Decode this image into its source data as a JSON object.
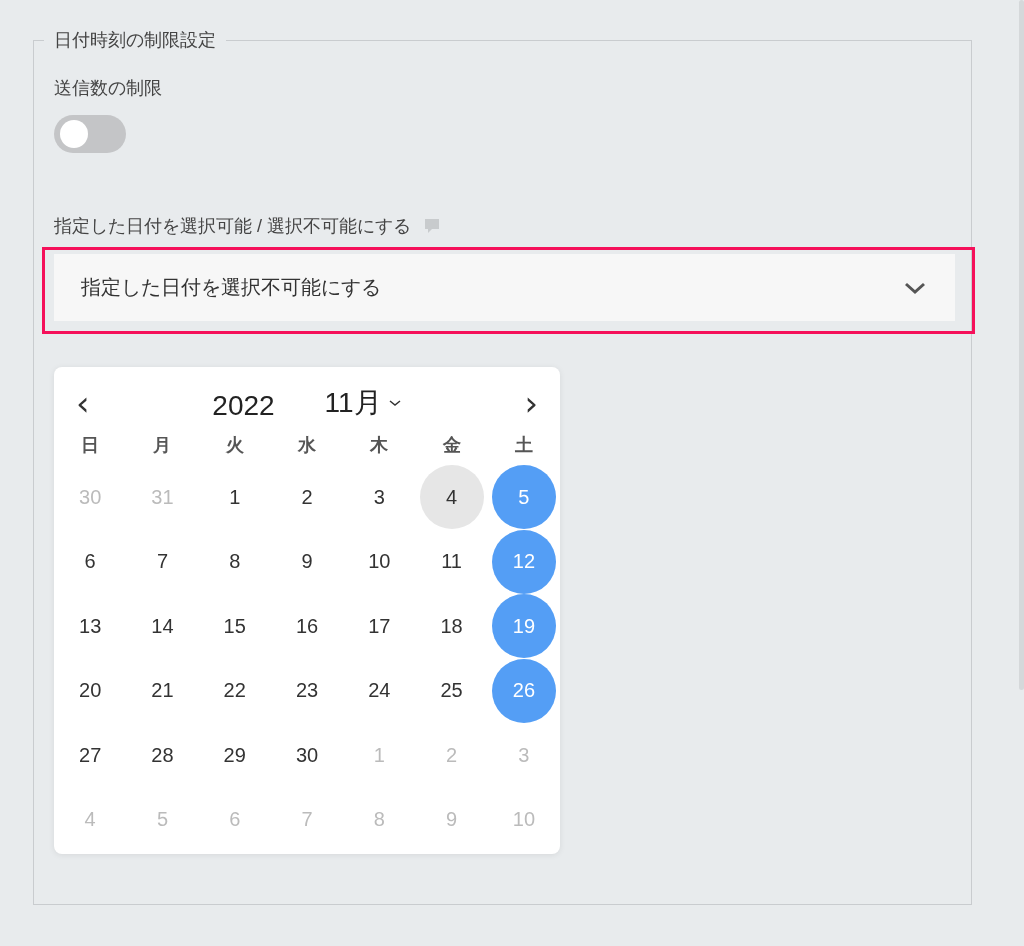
{
  "section": {
    "title": "日付時刻の制限設定"
  },
  "send_limit": {
    "label": "送信数の制限",
    "on": false
  },
  "date_mode": {
    "label": "指定した日付を選択可能 / 選択不可能にする",
    "value": "指定した日付を選択不可能にする",
    "focused": true
  },
  "calendar": {
    "prev": "‹",
    "next": "›",
    "year": "2022",
    "month": "11月",
    "weekdays": [
      "日",
      "月",
      "火",
      "水",
      "木",
      "金",
      "土"
    ],
    "days": [
      {
        "label": "30",
        "outside": true,
        "selected": false,
        "hovered": false
      },
      {
        "label": "31",
        "outside": true,
        "selected": false,
        "hovered": false
      },
      {
        "label": "1",
        "outside": false,
        "selected": false,
        "hovered": false
      },
      {
        "label": "2",
        "outside": false,
        "selected": false,
        "hovered": false
      },
      {
        "label": "3",
        "outside": false,
        "selected": false,
        "hovered": false
      },
      {
        "label": "4",
        "outside": false,
        "selected": false,
        "hovered": true
      },
      {
        "label": "5",
        "outside": false,
        "selected": true,
        "hovered": false
      },
      {
        "label": "6",
        "outside": false,
        "selected": false,
        "hovered": false
      },
      {
        "label": "7",
        "outside": false,
        "selected": false,
        "hovered": false
      },
      {
        "label": "8",
        "outside": false,
        "selected": false,
        "hovered": false
      },
      {
        "label": "9",
        "outside": false,
        "selected": false,
        "hovered": false
      },
      {
        "label": "10",
        "outside": false,
        "selected": false,
        "hovered": false
      },
      {
        "label": "11",
        "outside": false,
        "selected": false,
        "hovered": false
      },
      {
        "label": "12",
        "outside": false,
        "selected": true,
        "hovered": false
      },
      {
        "label": "13",
        "outside": false,
        "selected": false,
        "hovered": false
      },
      {
        "label": "14",
        "outside": false,
        "selected": false,
        "hovered": false
      },
      {
        "label": "15",
        "outside": false,
        "selected": false,
        "hovered": false
      },
      {
        "label": "16",
        "outside": false,
        "selected": false,
        "hovered": false
      },
      {
        "label": "17",
        "outside": false,
        "selected": false,
        "hovered": false
      },
      {
        "label": "18",
        "outside": false,
        "selected": false,
        "hovered": false
      },
      {
        "label": "19",
        "outside": false,
        "selected": true,
        "hovered": false
      },
      {
        "label": "20",
        "outside": false,
        "selected": false,
        "hovered": false
      },
      {
        "label": "21",
        "outside": false,
        "selected": false,
        "hovered": false
      },
      {
        "label": "22",
        "outside": false,
        "selected": false,
        "hovered": false
      },
      {
        "label": "23",
        "outside": false,
        "selected": false,
        "hovered": false
      },
      {
        "label": "24",
        "outside": false,
        "selected": false,
        "hovered": false
      },
      {
        "label": "25",
        "outside": false,
        "selected": false,
        "hovered": false
      },
      {
        "label": "26",
        "outside": false,
        "selected": true,
        "hovered": false
      },
      {
        "label": "27",
        "outside": false,
        "selected": false,
        "hovered": false
      },
      {
        "label": "28",
        "outside": false,
        "selected": false,
        "hovered": false
      },
      {
        "label": "29",
        "outside": false,
        "selected": false,
        "hovered": false
      },
      {
        "label": "30",
        "outside": false,
        "selected": false,
        "hovered": false
      },
      {
        "label": "1",
        "outside": true,
        "selected": false,
        "hovered": false
      },
      {
        "label": "2",
        "outside": true,
        "selected": false,
        "hovered": false
      },
      {
        "label": "3",
        "outside": true,
        "selected": false,
        "hovered": false
      },
      {
        "label": "4",
        "outside": true,
        "selected": false,
        "hovered": false
      },
      {
        "label": "5",
        "outside": true,
        "selected": false,
        "hovered": false
      },
      {
        "label": "6",
        "outside": true,
        "selected": false,
        "hovered": false
      },
      {
        "label": "7",
        "outside": true,
        "selected": false,
        "hovered": false
      },
      {
        "label": "8",
        "outside": true,
        "selected": false,
        "hovered": false
      },
      {
        "label": "9",
        "outside": true,
        "selected": false,
        "hovered": false
      },
      {
        "label": "10",
        "outside": true,
        "selected": false,
        "hovered": false
      }
    ]
  }
}
